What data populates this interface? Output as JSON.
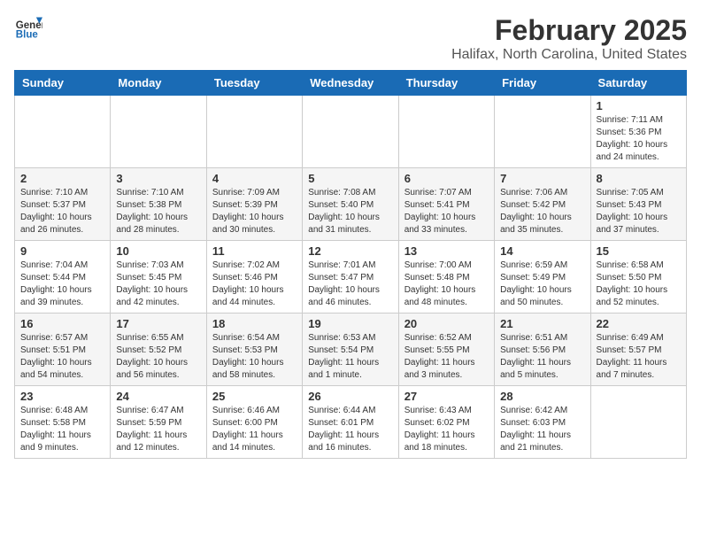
{
  "header": {
    "logo_line1": "General",
    "logo_line2": "Blue",
    "month": "February 2025",
    "location": "Halifax, North Carolina, United States"
  },
  "days_of_week": [
    "Sunday",
    "Monday",
    "Tuesday",
    "Wednesday",
    "Thursday",
    "Friday",
    "Saturday"
  ],
  "weeks": [
    [
      {
        "day": "",
        "info": ""
      },
      {
        "day": "",
        "info": ""
      },
      {
        "day": "",
        "info": ""
      },
      {
        "day": "",
        "info": ""
      },
      {
        "day": "",
        "info": ""
      },
      {
        "day": "",
        "info": ""
      },
      {
        "day": "1",
        "info": "Sunrise: 7:11 AM\nSunset: 5:36 PM\nDaylight: 10 hours\nand 24 minutes."
      }
    ],
    [
      {
        "day": "2",
        "info": "Sunrise: 7:10 AM\nSunset: 5:37 PM\nDaylight: 10 hours\nand 26 minutes."
      },
      {
        "day": "3",
        "info": "Sunrise: 7:10 AM\nSunset: 5:38 PM\nDaylight: 10 hours\nand 28 minutes."
      },
      {
        "day": "4",
        "info": "Sunrise: 7:09 AM\nSunset: 5:39 PM\nDaylight: 10 hours\nand 30 minutes."
      },
      {
        "day": "5",
        "info": "Sunrise: 7:08 AM\nSunset: 5:40 PM\nDaylight: 10 hours\nand 31 minutes."
      },
      {
        "day": "6",
        "info": "Sunrise: 7:07 AM\nSunset: 5:41 PM\nDaylight: 10 hours\nand 33 minutes."
      },
      {
        "day": "7",
        "info": "Sunrise: 7:06 AM\nSunset: 5:42 PM\nDaylight: 10 hours\nand 35 minutes."
      },
      {
        "day": "8",
        "info": "Sunrise: 7:05 AM\nSunset: 5:43 PM\nDaylight: 10 hours\nand 37 minutes."
      }
    ],
    [
      {
        "day": "9",
        "info": "Sunrise: 7:04 AM\nSunset: 5:44 PM\nDaylight: 10 hours\nand 39 minutes."
      },
      {
        "day": "10",
        "info": "Sunrise: 7:03 AM\nSunset: 5:45 PM\nDaylight: 10 hours\nand 42 minutes."
      },
      {
        "day": "11",
        "info": "Sunrise: 7:02 AM\nSunset: 5:46 PM\nDaylight: 10 hours\nand 44 minutes."
      },
      {
        "day": "12",
        "info": "Sunrise: 7:01 AM\nSunset: 5:47 PM\nDaylight: 10 hours\nand 46 minutes."
      },
      {
        "day": "13",
        "info": "Sunrise: 7:00 AM\nSunset: 5:48 PM\nDaylight: 10 hours\nand 48 minutes."
      },
      {
        "day": "14",
        "info": "Sunrise: 6:59 AM\nSunset: 5:49 PM\nDaylight: 10 hours\nand 50 minutes."
      },
      {
        "day": "15",
        "info": "Sunrise: 6:58 AM\nSunset: 5:50 PM\nDaylight: 10 hours\nand 52 minutes."
      }
    ],
    [
      {
        "day": "16",
        "info": "Sunrise: 6:57 AM\nSunset: 5:51 PM\nDaylight: 10 hours\nand 54 minutes."
      },
      {
        "day": "17",
        "info": "Sunrise: 6:55 AM\nSunset: 5:52 PM\nDaylight: 10 hours\nand 56 minutes."
      },
      {
        "day": "18",
        "info": "Sunrise: 6:54 AM\nSunset: 5:53 PM\nDaylight: 10 hours\nand 58 minutes."
      },
      {
        "day": "19",
        "info": "Sunrise: 6:53 AM\nSunset: 5:54 PM\nDaylight: 11 hours\nand 1 minute."
      },
      {
        "day": "20",
        "info": "Sunrise: 6:52 AM\nSunset: 5:55 PM\nDaylight: 11 hours\nand 3 minutes."
      },
      {
        "day": "21",
        "info": "Sunrise: 6:51 AM\nSunset: 5:56 PM\nDaylight: 11 hours\nand 5 minutes."
      },
      {
        "day": "22",
        "info": "Sunrise: 6:49 AM\nSunset: 5:57 PM\nDaylight: 11 hours\nand 7 minutes."
      }
    ],
    [
      {
        "day": "23",
        "info": "Sunrise: 6:48 AM\nSunset: 5:58 PM\nDaylight: 11 hours\nand 9 minutes."
      },
      {
        "day": "24",
        "info": "Sunrise: 6:47 AM\nSunset: 5:59 PM\nDaylight: 11 hours\nand 12 minutes."
      },
      {
        "day": "25",
        "info": "Sunrise: 6:46 AM\nSunset: 6:00 PM\nDaylight: 11 hours\nand 14 minutes."
      },
      {
        "day": "26",
        "info": "Sunrise: 6:44 AM\nSunset: 6:01 PM\nDaylight: 11 hours\nand 16 minutes."
      },
      {
        "day": "27",
        "info": "Sunrise: 6:43 AM\nSunset: 6:02 PM\nDaylight: 11 hours\nand 18 minutes."
      },
      {
        "day": "28",
        "info": "Sunrise: 6:42 AM\nSunset: 6:03 PM\nDaylight: 11 hours\nand 21 minutes."
      },
      {
        "day": "",
        "info": ""
      }
    ]
  ]
}
